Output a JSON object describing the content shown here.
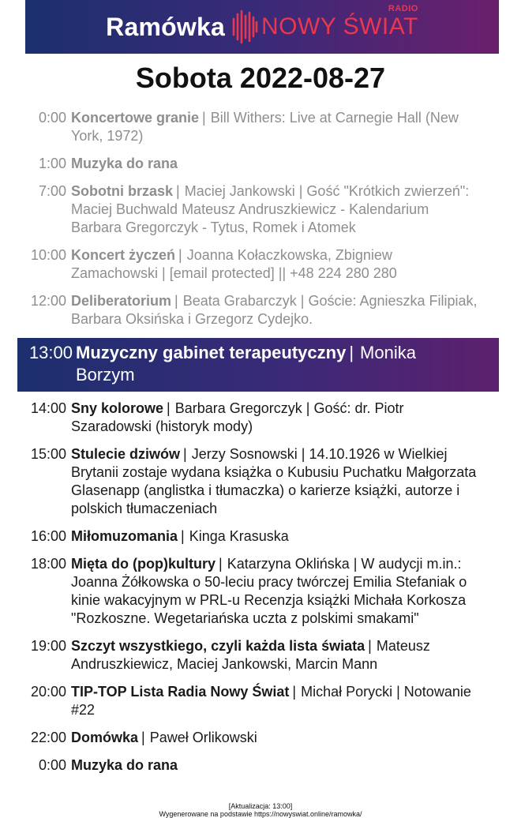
{
  "header": {
    "title": "Ramówka",
    "brand": "NOWY ŚWIAT",
    "radio": "RADIO"
  },
  "date_heading": "Sobota 2022-08-27",
  "past_items": [
    {
      "time": "0:00",
      "name": "Koncertowe granie",
      "sep": "|",
      "info": "Bill Withers: Live at Carnegie Hall (New York, 1972)"
    },
    {
      "time": "1:00",
      "name": "Muzyka do rana",
      "sep": "",
      "info": ""
    },
    {
      "time": "7:00",
      "name": "Sobotni brzask",
      "sep": "|",
      "info": "Maciej Jankowski  |  Gość \"Krótkich zwierzeń\": Maciej Buchwald Mateusz Andruszkiewicz - Kalendarium Barbara Gregorczyk - Tytus, Romek i Atomek"
    },
    {
      "time": "10:00",
      "name": "Koncert życzeń",
      "sep": "|",
      "info": "Joanna Kołaczkowska, Zbigniew Zamachowski  |  [email protected] || +48 224 280 280"
    },
    {
      "time": "12:00",
      "name": "Deliberatorium",
      "sep": "|",
      "info": "Beata Grabarczyk  | Goście: Agnieszka Filipiak, Barbara Oksińska i Grzegorz Cydejko."
    }
  ],
  "current_item": {
    "time": "13:00",
    "name": "Muzyczny gabinet terapeutyczny",
    "sep": "|",
    "info": "Monika Borzym"
  },
  "future_items": [
    {
      "time": "14:00",
      "name": "Sny kolorowe",
      "sep": "|",
      "info": "Barbara Gregorczyk  |  Gość: dr. Piotr Szaradowski (historyk mody)"
    },
    {
      "time": "15:00",
      "name": "Stulecie dziwów",
      "sep": "|",
      "info": "Jerzy Sosnowski  |  14.10.1926 w Wielkiej Brytanii zostaje wydana książka o Kubusiu Puchatku Małgorzata Glasenapp (anglistka i tłumaczka) o karierze książki, autorze i polskich tłumaczeniach"
    },
    {
      "time": "16:00",
      "name": "Miłomuzomania",
      "sep": "|",
      "info": "Kinga Krasuska"
    },
    {
      "time": "18:00",
      "name": "Mięta do (pop)kultury",
      "sep": "|",
      "info": "Katarzyna Oklińska  |  W audycji m.in.: Joanna Żółkowska o 50-leciu pracy twórczej Emilia Stefaniak o kinie wakacyjnym w PRL-u Recenzja książki Michała Korkosza \"Rozkoszne. Wegetariańska uczta z polskimi smakami\""
    },
    {
      "time": "19:00",
      "name": "Szczyt wszystkiego, czyli każda lista świata",
      "sep": "|",
      "info": "Mateusz Andruszkiewicz, Maciej Jankowski, Marcin Mann"
    },
    {
      "time": "20:00",
      "name": "TIP-TOP Lista Radia Nowy Świat",
      "sep": "|",
      "info": "Michał Porycki  |  Notowanie #22"
    },
    {
      "time": "22:00",
      "name": "Domówka",
      "sep": "|",
      "info": "Paweł Orlikowski"
    },
    {
      "time": "0:00",
      "name": "Muzyka do rana",
      "sep": "",
      "info": ""
    }
  ],
  "footer": {
    "updated": "[Aktualizacja: 13:00]",
    "source": "Wygenerowane na podstawie https://nowyswiat.online/ramowka/"
  },
  "colors": {
    "accent": "#e8384f",
    "banner_start": "#1c2f6e",
    "banner_end": "#6a1f6c",
    "past_text": "#8e8e8e"
  }
}
